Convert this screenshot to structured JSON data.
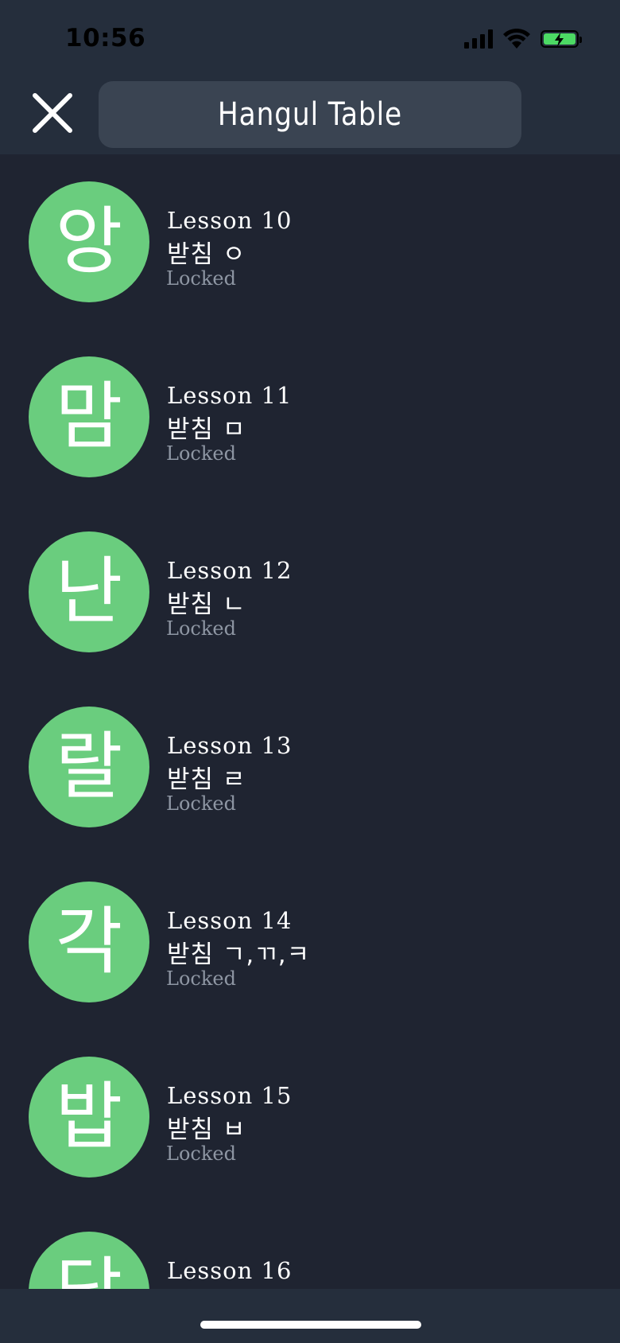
{
  "status_bar": {
    "time": "10:56"
  },
  "header": {
    "title": "Hangul Table",
    "close_icon": "close-icon"
  },
  "lessons": [
    {
      "char": "앙",
      "number": "Lesson 10",
      "subtitle": "받침 ㅇ",
      "status": "Locked"
    },
    {
      "char": "맘",
      "number": "Lesson 11",
      "subtitle": "받침 ㅁ",
      "status": "Locked"
    },
    {
      "char": "난",
      "number": "Lesson 12",
      "subtitle": "받침 ㄴ",
      "status": "Locked"
    },
    {
      "char": "랄",
      "number": "Lesson 13",
      "subtitle": "받침 ㄹ",
      "status": "Locked"
    },
    {
      "char": "각",
      "number": "Lesson 14",
      "subtitle": "받침 ㄱ,ㄲ,ㅋ",
      "status": "Locked"
    },
    {
      "char": "밥",
      "number": "Lesson 15",
      "subtitle": "받침 ㅂ",
      "status": "Locked"
    },
    {
      "char": "닫",
      "number": "Lesson 16",
      "subtitle": "",
      "status": ""
    }
  ],
  "colors": {
    "background": "#1f2431",
    "header": "#252e3c",
    "title_box": "#3a4452",
    "lesson_circle": "#6acd7e",
    "locked_text": "#8e96a3"
  }
}
